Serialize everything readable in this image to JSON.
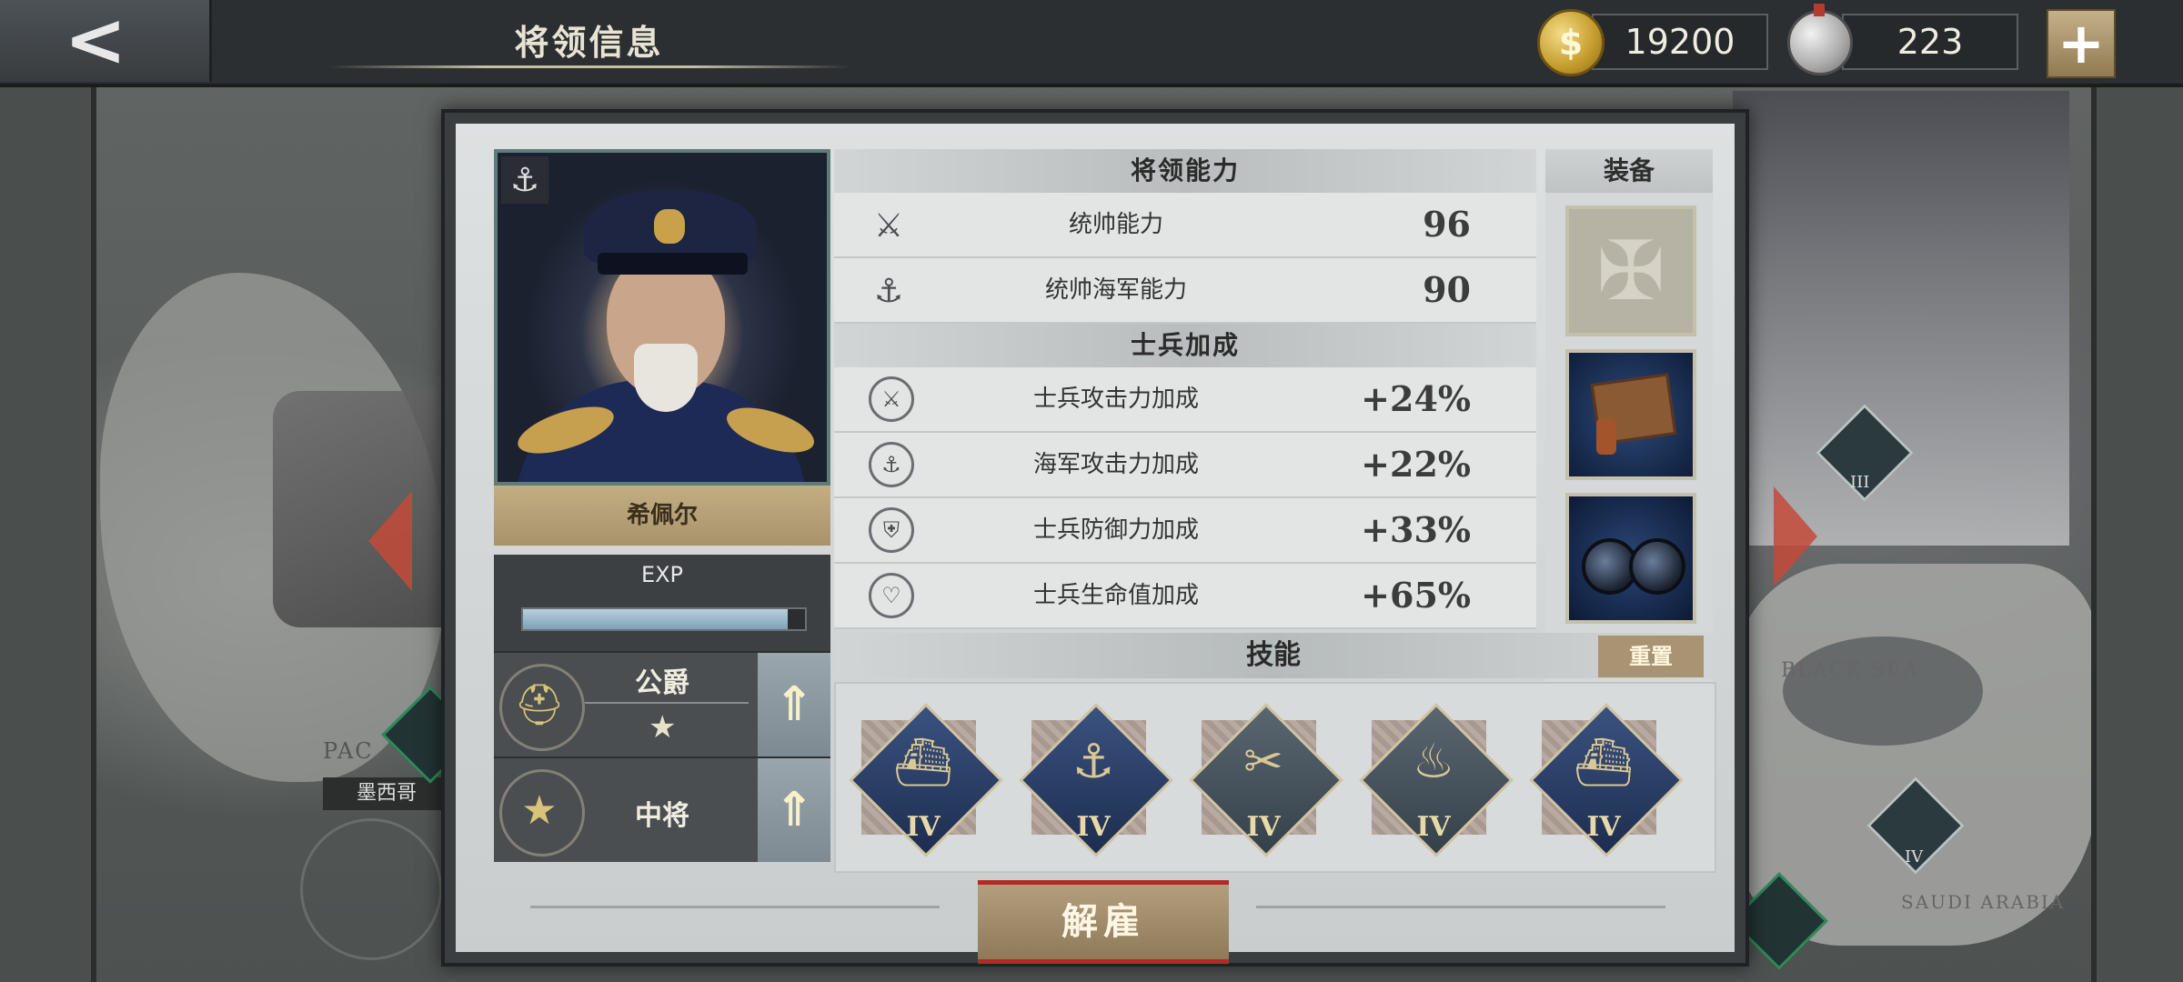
{
  "header": {
    "title": "将领信息",
    "gold_amount": "19200",
    "silver_amount": "223"
  },
  "general": {
    "name": "希佩尔",
    "exp_label": "EXP",
    "exp_progress": 0.94,
    "ranks": [
      {
        "title": "公爵",
        "stars": "★"
      },
      {
        "title": "中将"
      }
    ]
  },
  "abilities": {
    "heading": "将领能力",
    "rows": [
      {
        "label": "统帅能力",
        "value": "96",
        "icon": "crossed-swords-icon"
      },
      {
        "label": "统帅海军能力",
        "value": "90",
        "icon": "anchor-icon"
      }
    ]
  },
  "bonuses": {
    "heading": "士兵加成",
    "rows": [
      {
        "label": "士兵攻击力加成",
        "value": "+24%",
        "icon": "attack-plus-icon"
      },
      {
        "label": "海军攻击力加成",
        "value": "+22%",
        "icon": "naval-attack-plus-icon"
      },
      {
        "label": "士兵防御力加成",
        "value": "+33%",
        "icon": "defense-plus-icon"
      },
      {
        "label": "士兵生命值加成",
        "value": "+65%",
        "icon": "health-plus-icon"
      }
    ]
  },
  "equipment": {
    "heading": "装备",
    "slots": [
      "medal-slot-empty",
      "supply-crate",
      "binoculars"
    ]
  },
  "skills": {
    "heading": "技能",
    "reset_label": "重置",
    "items": [
      {
        "icon": "battleship-icon",
        "level": "IV"
      },
      {
        "icon": "anchor-laurel-icon",
        "level": "IV"
      },
      {
        "icon": "bandage-knife-icon",
        "level": "IV"
      },
      {
        "icon": "fire-shield-icon",
        "level": "IV"
      },
      {
        "icon": "ship-location-icon",
        "level": "IV"
      }
    ]
  },
  "actions": {
    "dismiss_label": "解雇"
  },
  "map": {
    "labels": [
      "BLACK SEA",
      "SAUDI ARABIA",
      "墨西哥",
      "PAC"
    ],
    "unit_levels": [
      "III",
      "IV"
    ]
  },
  "colors": {
    "accent_gold": "#c8a14a",
    "button_tan": "#a89373",
    "dismiss_red": "#b22a26"
  }
}
